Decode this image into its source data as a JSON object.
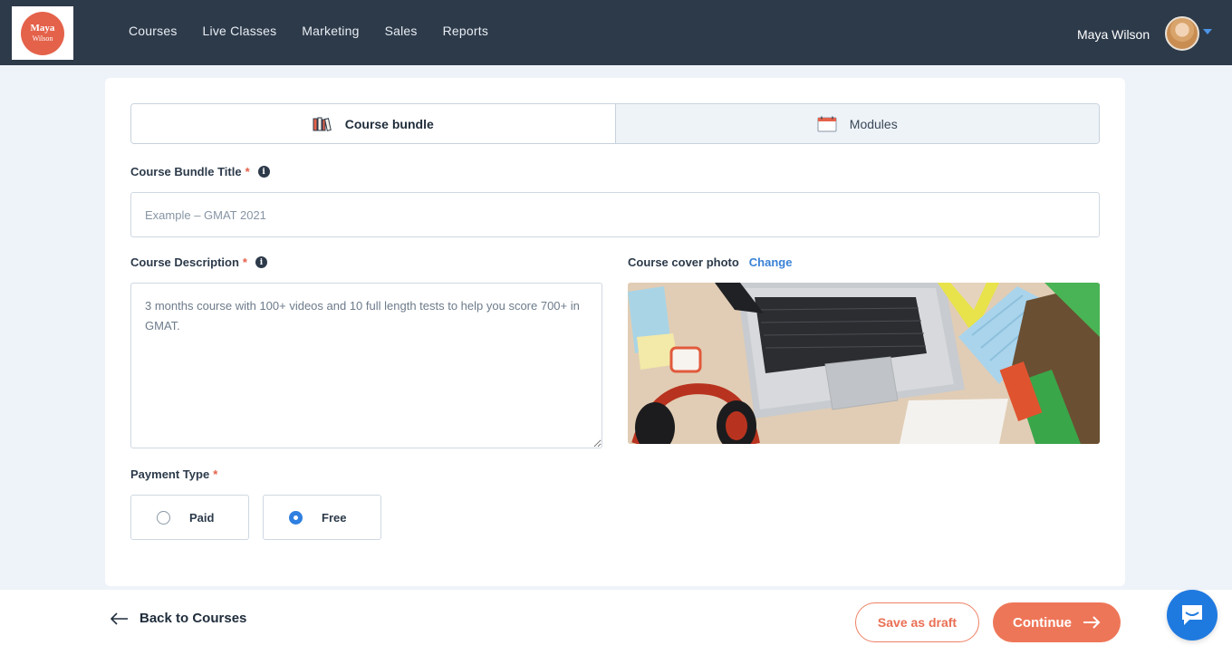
{
  "brand": {
    "logo_line1": "Maya",
    "logo_line2": "Wilson"
  },
  "nav": {
    "items": [
      {
        "label": "Courses"
      },
      {
        "label": "Live Classes"
      },
      {
        "label": "Marketing"
      },
      {
        "label": "Sales"
      },
      {
        "label": "Reports"
      }
    ]
  },
  "user": {
    "name": "Maya Wilson",
    "avatar_icon": "user-avatar"
  },
  "tabs": [
    {
      "label": "Course bundle",
      "icon": "books-icon",
      "active": true
    },
    {
      "label": "Modules",
      "icon": "calendar-icon",
      "active": false
    }
  ],
  "form": {
    "title": {
      "label": "Course Bundle Title",
      "required_mark": "*",
      "placeholder": "Example – GMAT 2021",
      "value": ""
    },
    "description": {
      "label": "Course Description",
      "required_mark": "*",
      "value": "3 months course with 100+ videos and 10 full length tests to help you score 700+ in GMAT."
    },
    "cover": {
      "label": "Course cover photo",
      "change_label": "Change"
    },
    "payment": {
      "label": "Payment Type",
      "required_mark": "*",
      "options": [
        {
          "label": "Paid",
          "selected": false
        },
        {
          "label": "Free",
          "selected": true
        }
      ]
    }
  },
  "footer": {
    "back_label": "Back to Courses",
    "draft_label": "Save as draft",
    "continue_label": "Continue"
  },
  "colors": {
    "header_bg": "#2d3a4a",
    "accent": "#ee7658",
    "link": "#3a82d6",
    "radio_selected": "#2f7fe0",
    "chat": "#1f7ae0"
  }
}
